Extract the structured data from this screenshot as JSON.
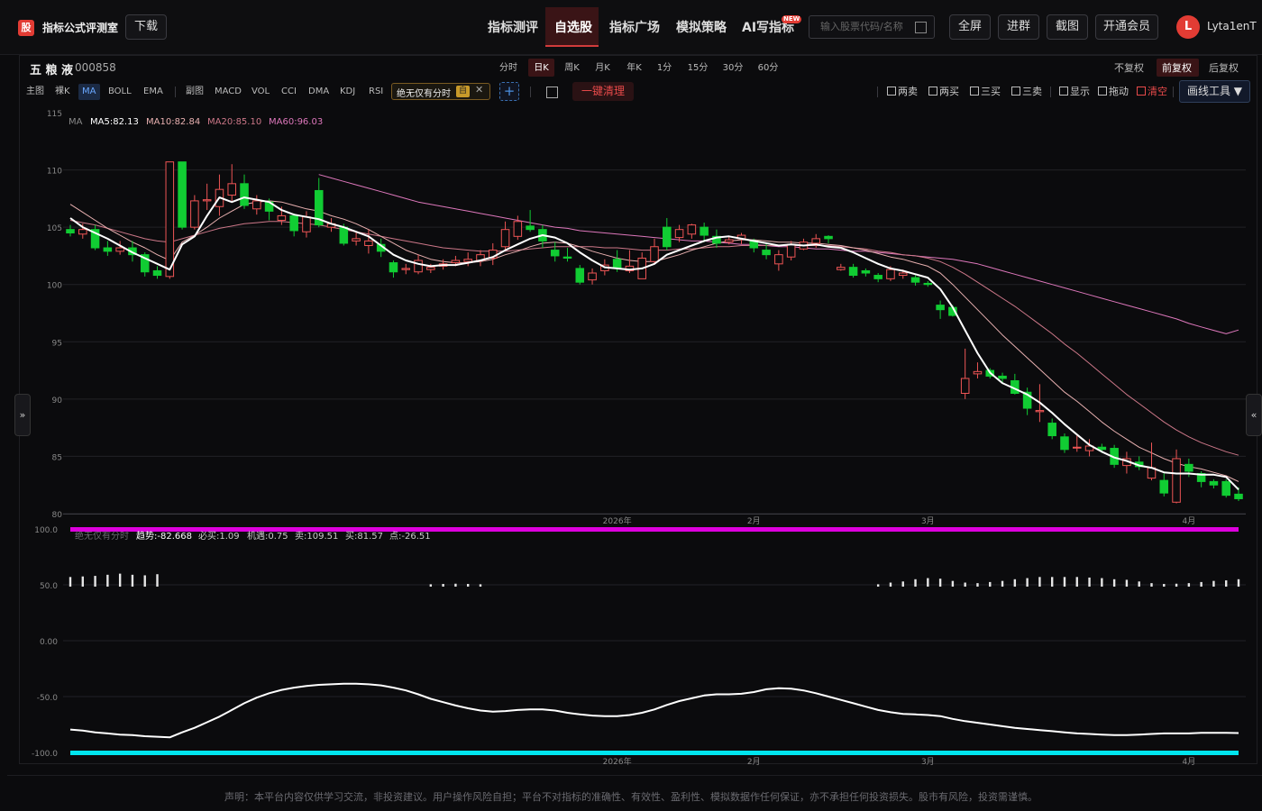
{
  "header": {
    "logo_char": "股",
    "app_title": "指标公式评测室",
    "download_label": "下载",
    "nav": [
      "指标测评",
      "自选股",
      "指标广场",
      "模拟策略",
      "AI写指标"
    ],
    "nav_active": "自选股",
    "new_badge": "NEW",
    "search_placeholder": "输入股票代码/名称",
    "buttons": [
      "全屏",
      "进群",
      "截图",
      "开通会员"
    ],
    "avatar_initial": "L",
    "username": "Lyta1enT"
  },
  "stock": {
    "name": "五 粮 液",
    "code": "000858"
  },
  "timeframes": [
    "分时",
    "日K",
    "周K",
    "月K",
    "年K",
    "1分",
    "15分",
    "30分",
    "60分"
  ],
  "timeframe_active": "日K",
  "adjustments": [
    "不复权",
    "前复权",
    "后复权"
  ],
  "adjustment_active": "前复权",
  "indicators": {
    "main_label": "主图",
    "main": [
      "裸K",
      "MA",
      "BOLL",
      "EMA"
    ],
    "main_active": "MA",
    "sub_label": "副图",
    "sub": [
      "MACD",
      "VOL",
      "CCI",
      "DMA",
      "KDJ",
      "RSI"
    ],
    "special_name": "绝无仅有分时",
    "special_badge": "自",
    "add_label": "+",
    "clear_label": "一键清理"
  },
  "signals": [
    "两卖",
    "两买",
    "三买",
    "三卖",
    "显示",
    "拖动",
    "清空"
  ],
  "draw_tools_label": "画线工具 ▼",
  "side_left": "»",
  "side_right": "«",
  "colors": {
    "up": "#ee5555",
    "down": "#11cc33",
    "ma5": "#ffffff",
    "ma10": "#e8b0b0",
    "ma20": "#cc7788",
    "ma60": "#dd77bb",
    "accent": "#e23c34",
    "sub_top": "#dd00dd",
    "sub_bottom": "#00e5ee",
    "sub_line": "#ffffff"
  },
  "chart_data": {
    "type": "candlestick",
    "main": {
      "ylim": [
        80,
        115
      ],
      "yticks": [
        115,
        110,
        105,
        100,
        95,
        90,
        85,
        80
      ],
      "legend_label": "MA",
      "legend": [
        "MA5:82.13",
        "MA10:82.84",
        "MA20:85.10",
        "MA60:96.03"
      ],
      "xticks": [
        "2026年",
        "2月",
        "3月",
        "4月"
      ],
      "candles": [
        [
          104.8,
          104.5,
          105.2,
          104.2
        ],
        [
          104.4,
          104.8,
          105.3,
          104.0
        ],
        [
          104.8,
          103.2,
          105.2,
          103.0
        ],
        [
          103.2,
          102.9,
          103.8,
          102.5
        ],
        [
          102.9,
          103.2,
          103.8,
          102.6
        ],
        [
          103.2,
          102.6,
          103.8,
          102.0
        ],
        [
          102.6,
          101.1,
          102.8,
          100.7
        ],
        [
          101.2,
          100.8,
          101.6,
          100.5
        ],
        [
          100.7,
          110.7,
          110.7,
          100.5
        ],
        [
          110.7,
          105.0,
          110.7,
          104.8
        ],
        [
          105.0,
          107.3,
          107.8,
          104.8
        ],
        [
          107.3,
          107.4,
          108.8,
          106.5
        ],
        [
          106.8,
          108.3,
          109.6,
          106.0
        ],
        [
          107.8,
          108.8,
          110.5,
          107.2
        ],
        [
          108.8,
          106.9,
          109.6,
          106.6
        ],
        [
          106.6,
          107.3,
          107.8,
          106.1
        ],
        [
          107.2,
          106.4,
          107.5,
          105.6
        ],
        [
          105.6,
          106.0,
          106.8,
          105.2
        ],
        [
          106.0,
          104.7,
          106.2,
          104.2
        ],
        [
          104.6,
          105.9,
          106.4,
          104.1
        ],
        [
          108.2,
          105.2,
          109.3,
          105.0
        ],
        [
          105.0,
          105.3,
          105.8,
          104.6
        ],
        [
          105.0,
          103.6,
          105.3,
          103.4
        ],
        [
          103.8,
          104.0,
          104.6,
          103.4
        ],
        [
          103.4,
          103.8,
          104.8,
          102.7
        ],
        [
          103.5,
          102.9,
          104.0,
          102.4
        ],
        [
          101.9,
          101.1,
          102.1,
          100.6
        ],
        [
          101.3,
          101.4,
          101.8,
          100.9
        ],
        [
          101.1,
          102.1,
          102.6,
          100.9
        ],
        [
          101.3,
          101.5,
          101.8,
          101.0
        ],
        [
          101.6,
          101.8,
          102.2,
          101.3
        ],
        [
          101.9,
          102.1,
          102.5,
          101.6
        ],
        [
          102.0,
          102.2,
          102.8,
          101.6
        ],
        [
          102.1,
          102.6,
          103.0,
          101.6
        ],
        [
          102.3,
          103.0,
          103.6,
          101.7
        ],
        [
          103.3,
          104.8,
          105.5,
          103.0
        ],
        [
          104.2,
          105.5,
          106.0,
          103.9
        ],
        [
          105.1,
          104.8,
          106.5,
          104.6
        ],
        [
          104.8,
          103.8,
          105.2,
          103.2
        ],
        [
          103.0,
          102.5,
          103.7,
          102.0
        ],
        [
          102.4,
          102.3,
          103.2,
          102.0
        ],
        [
          101.4,
          100.2,
          101.7,
          100.0
        ],
        [
          100.4,
          101.0,
          101.4,
          100.0
        ],
        [
          101.2,
          101.7,
          102.2,
          100.8
        ],
        [
          102.2,
          101.4,
          103.0,
          101.1
        ],
        [
          101.2,
          101.6,
          103.0,
          101.0
        ],
        [
          100.5,
          102.3,
          102.8,
          100.5
        ],
        [
          102.0,
          103.3,
          104.0,
          101.8
        ],
        [
          105.0,
          103.3,
          105.8,
          103.0
        ],
        [
          104.1,
          104.8,
          105.2,
          103.7
        ],
        [
          104.4,
          105.2,
          105.3,
          104.0
        ],
        [
          105.0,
          104.3,
          105.4,
          103.7
        ],
        [
          104.2,
          103.6,
          104.8,
          103.2
        ],
        [
          103.7,
          103.9,
          104.2,
          103.5
        ],
        [
          104.0,
          104.3,
          104.5,
          103.5
        ],
        [
          103.8,
          103.2,
          104.0,
          102.8
        ],
        [
          103.0,
          102.6,
          103.6,
          102.2
        ],
        [
          101.8,
          102.6,
          103.0,
          101.2
        ],
        [
          102.4,
          103.5,
          103.8,
          102.1
        ],
        [
          103.1,
          103.7,
          104.0,
          103.0
        ],
        [
          103.6,
          104.0,
          104.4,
          103.2
        ],
        [
          104.2,
          104.0,
          104.3,
          103.6
        ],
        [
          101.3,
          101.5,
          101.8,
          101.2
        ],
        [
          101.5,
          100.8,
          101.8,
          100.6
        ],
        [
          101.2,
          101.0,
          101.4,
          100.7
        ],
        [
          100.8,
          100.5,
          101.0,
          100.2
        ],
        [
          100.5,
          101.3,
          101.6,
          100.3
        ],
        [
          100.8,
          101.0,
          101.3,
          100.5
        ],
        [
          100.6,
          100.2,
          100.8,
          99.9
        ],
        [
          100.1,
          100.0,
          100.3,
          99.8
        ],
        [
          98.2,
          97.8,
          98.6,
          97.0
        ],
        [
          98.0,
          97.3,
          98.2,
          97.2
        ],
        [
          90.5,
          91.8,
          94.4,
          90.0
        ],
        [
          92.2,
          92.4,
          93.2,
          91.8
        ],
        [
          92.5,
          92.0,
          92.7,
          91.8
        ],
        [
          92.0,
          91.8,
          92.3,
          91.4
        ],
        [
          91.6,
          90.5,
          92.2,
          90.4
        ],
        [
          90.6,
          89.2,
          91.0,
          88.6
        ],
        [
          88.9,
          89.0,
          91.3,
          88.0
        ],
        [
          87.9,
          86.8,
          88.3,
          86.5
        ],
        [
          86.7,
          85.6,
          87.0,
          85.3
        ],
        [
          85.8,
          85.8,
          86.8,
          85.4
        ],
        [
          85.5,
          85.9,
          86.5,
          85.0
        ],
        [
          85.8,
          85.6,
          86.1,
          85.3
        ],
        [
          85.7,
          84.3,
          86.0,
          84.0
        ],
        [
          84.2,
          84.8,
          85.4,
          83.5
        ],
        [
          84.5,
          84.1,
          85.0,
          83.8
        ],
        [
          83.1,
          84.0,
          86.2,
          82.9
        ],
        [
          82.9,
          81.8,
          83.5,
          81.5
        ],
        [
          81.0,
          84.8,
          85.6,
          80.9
        ],
        [
          84.3,
          83.7,
          84.8,
          83.2
        ],
        [
          83.5,
          82.8,
          83.7,
          82.3
        ],
        [
          82.8,
          82.5,
          83.0,
          82.2
        ],
        [
          82.8,
          81.6,
          83.0,
          81.4
        ],
        [
          81.7,
          81.3,
          82.3,
          81.1
        ]
      ],
      "ma5": [
        105.8,
        105.0,
        104.5,
        104.0,
        103.4,
        102.8,
        102.3,
        101.8,
        101.3,
        103.5,
        104.2,
        106.0,
        107.6,
        107.2,
        107.6,
        107.4,
        107.2,
        106.5,
        106.1,
        105.9,
        105.7,
        105.3,
        105.0,
        104.6,
        104.2,
        103.4,
        102.6,
        102.1,
        101.8,
        101.6,
        101.7,
        101.7,
        101.9,
        102.1,
        102.4,
        103.0,
        103.5,
        104.0,
        104.3,
        104.1,
        103.6,
        102.8,
        102.1,
        101.5,
        101.4,
        101.3,
        101.4,
        101.8,
        102.6,
        103.0,
        103.4,
        103.8,
        104.1,
        104.2,
        104.0,
        103.8,
        103.6,
        103.4,
        103.5,
        103.4,
        103.5,
        103.3,
        103.2,
        102.8,
        102.3,
        101.8,
        101.4,
        101.2,
        100.9,
        100.6,
        99.6,
        98.0,
        96.0,
        94.0,
        92.3,
        91.4,
        90.9,
        90.4,
        89.7,
        88.8,
        87.8,
        86.9,
        86.0,
        85.4,
        84.9,
        84.6,
        84.2,
        84.0,
        83.6,
        83.5,
        83.5,
        83.4,
        83.4,
        83.2,
        82.1
      ],
      "ma10": [
        107.0,
        106.3,
        105.6,
        104.9,
        104.3,
        103.7,
        103.2,
        102.6,
        102.1,
        103.7,
        104.3,
        105.0,
        105.8,
        106.4,
        107.0,
        107.2,
        107.3,
        107.2,
        106.9,
        106.6,
        106.4,
        106.0,
        105.7,
        105.3,
        104.8,
        104.2,
        103.6,
        103.0,
        102.6,
        102.2,
        102.0,
        101.9,
        101.9,
        102.0,
        102.2,
        102.6,
        102.9,
        103.3,
        103.6,
        103.7,
        103.6,
        103.3,
        102.9,
        102.6,
        102.3,
        102.1,
        102.0,
        102.0,
        102.3,
        102.6,
        103.0,
        103.3,
        103.6,
        103.8,
        103.9,
        103.9,
        103.8,
        103.7,
        103.7,
        103.6,
        103.6,
        103.5,
        103.4,
        103.2,
        103.0,
        102.7,
        102.4,
        102.2,
        101.9,
        101.6,
        101.0,
        100.0,
        98.9,
        97.8,
        96.7,
        95.6,
        94.6,
        93.6,
        92.6,
        91.6,
        90.6,
        89.8,
        88.9,
        88.0,
        87.2,
        86.5,
        85.8,
        85.3,
        84.8,
        84.4,
        84.1,
        83.9,
        83.6,
        83.3,
        82.8
      ],
      "ma20": [
        105.6,
        105.4,
        105.2,
        104.9,
        104.6,
        104.3,
        104.0,
        103.8,
        103.7,
        104.0,
        104.3,
        104.6,
        104.9,
        105.1,
        105.3,
        105.4,
        105.5,
        105.5,
        105.4,
        105.3,
        105.2,
        105.0,
        104.8,
        104.6,
        104.4,
        104.2,
        104.0,
        103.8,
        103.6,
        103.4,
        103.2,
        103.1,
        103.0,
        102.9,
        102.9,
        102.9,
        103.0,
        103.1,
        103.2,
        103.3,
        103.3,
        103.3,
        103.3,
        103.2,
        103.2,
        103.1,
        103.0,
        103.0,
        103.0,
        103.1,
        103.1,
        103.2,
        103.3,
        103.3,
        103.4,
        103.4,
        103.4,
        103.4,
        103.4,
        103.4,
        103.4,
        103.4,
        103.3,
        103.2,
        103.1,
        102.9,
        102.8,
        102.6,
        102.5,
        102.3,
        102.0,
        101.5,
        100.9,
        100.2,
        99.5,
        98.8,
        98.1,
        97.3,
        96.5,
        95.7,
        94.8,
        94.0,
        93.1,
        92.2,
        91.3,
        90.4,
        89.6,
        88.8,
        88.0,
        87.3,
        86.7,
        86.2,
        85.8,
        85.4,
        85.1
      ],
      "ma60_start": 20,
      "ma60": [
        109.6,
        109.3,
        109.0,
        108.7,
        108.4,
        108.1,
        107.8,
        107.5,
        107.2,
        107.0,
        106.8,
        106.6,
        106.4,
        106.2,
        106.0,
        105.8,
        105.6,
        105.4,
        105.2,
        105.0,
        104.9,
        104.7,
        104.6,
        104.5,
        104.4,
        104.3,
        104.2,
        104.1,
        104.0,
        103.9,
        103.8,
        103.8,
        103.7,
        103.6,
        103.5,
        103.5,
        103.4,
        103.3,
        103.3,
        103.2,
        103.1,
        103.1,
        103.0,
        102.9,
        102.9,
        102.8,
        102.7,
        102.6,
        102.5,
        102.4,
        102.3,
        102.2,
        102.0,
        101.8,
        101.5,
        101.2,
        100.9,
        100.6,
        100.3,
        100.0,
        99.7,
        99.4,
        99.1,
        98.8,
        98.5,
        98.2,
        97.9,
        97.6,
        97.3,
        97.0,
        96.6,
        96.3,
        96.0,
        95.7,
        96.03
      ]
    },
    "sub": {
      "yticks": [
        "100.0",
        "50.0",
        "0.00",
        "-50.0",
        "-100.0"
      ],
      "ylim": [
        -100,
        100
      ],
      "legend_name": "绝无仅有分时",
      "legend": [
        "趋势:-82.668",
        "必买:1.09",
        "机遇:0.75",
        "卖:109.51",
        "买:81.57",
        "点:-26.51"
      ],
      "top_level": 100,
      "bottom_level": -100,
      "bars_idx": [
        0,
        1,
        2,
        3,
        4,
        5,
        6,
        7,
        29,
        30,
        31,
        32,
        33,
        65,
        66,
        67,
        68,
        69,
        70,
        71,
        72,
        73,
        74,
        75,
        76,
        77,
        78,
        79,
        80,
        81,
        82,
        83,
        84,
        85,
        86,
        87,
        88,
        89,
        90,
        91,
        92,
        93,
        94
      ],
      "bars_val": [
        57,
        57.5,
        58,
        59,
        60,
        59,
        58.5,
        59.5,
        50.5,
        50.8,
        51,
        50.8,
        50.5,
        50.5,
        52,
        53,
        55,
        56,
        55.5,
        53.5,
        52,
        51.5,
        52.5,
        53.5,
        55,
        56,
        57,
        57,
        57,
        57,
        56.5,
        56,
        55,
        54.5,
        53,
        51.5,
        50.8,
        51,
        51.5,
        52.5,
        53.5,
        54,
        55,
        54.5
      ],
      "trend": [
        -79.5,
        -80.5,
        -82.0,
        -83.0,
        -84.0,
        -84.5,
        -85.5,
        -86.0,
        -86.5,
        -82.0,
        -78.0,
        -73.0,
        -68.0,
        -62.0,
        -56.0,
        -51.0,
        -47.0,
        -44.0,
        -42.0,
        -40.5,
        -39.5,
        -39.0,
        -38.5,
        -38.5,
        -39.0,
        -40.0,
        -42.0,
        -44.5,
        -48.0,
        -52.0,
        -55.0,
        -58.0,
        -60.5,
        -62.5,
        -63.5,
        -63.0,
        -62.0,
        -61.5,
        -61.5,
        -62.5,
        -64.5,
        -66.0,
        -67.0,
        -67.5,
        -67.5,
        -66.5,
        -64.5,
        -61.5,
        -57.5,
        -54.0,
        -51.5,
        -49.0,
        -48.0,
        -48.0,
        -47.5,
        -46.0,
        -43.5,
        -42.5,
        -43.0,
        -44.5,
        -47.0,
        -50.0,
        -53.0,
        -56.0,
        -59.0,
        -62.0,
        -64.0,
        -65.5,
        -66.0,
        -66.5,
        -67.5,
        -70.0,
        -72.0,
        -73.5,
        -75.0,
        -76.5,
        -78.0,
        -79.0,
        -80.0,
        -81.0,
        -82.0,
        -83.0,
        -83.5,
        -84.0,
        -84.5,
        -84.5,
        -84.0,
        -83.5,
        -83.0,
        -83.0,
        -83.0,
        -82.5,
        -82.5,
        -82.5,
        -82.7
      ]
    }
  },
  "footer": {
    "disclaimer": "声明：本平台内容仅供学习交流，非投资建议。用户操作风险自担；平台不对指标的准确性、有效性、盈利性、模拟数据作任何保证，亦不承担任何投资损失。股市有风险，投资需谨慎。"
  }
}
